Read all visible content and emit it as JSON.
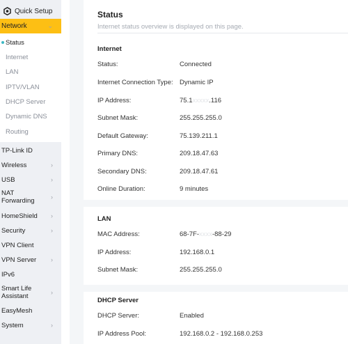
{
  "brand": {
    "label": "Quick Setup",
    "icon": "gear-icon"
  },
  "nav": {
    "active": {
      "label": "Network",
      "icon": "chevron-down-icon"
    },
    "sub_items": [
      "Status",
      "Internet",
      "LAN",
      "IPTV/VLAN",
      "DHCP Server",
      "Dynamic DNS",
      "Routing"
    ],
    "items": [
      "TP-Link ID",
      "Wireless",
      "USB",
      "NAT Forwarding",
      "HomeShield",
      "Security",
      "VPN Client",
      "VPN Server",
      "IPv6",
      "Smart Life Assistant",
      "EasyMesh",
      "System"
    ]
  },
  "page": {
    "title": "Status",
    "subtitle": "Internet status overview is displayed on this page."
  },
  "internet": {
    "title": "Internet",
    "rows": [
      {
        "label": "Status:",
        "value": "Connected"
      },
      {
        "label": "Internet Connection Type:",
        "value": "Dynamic IP"
      },
      {
        "label": "IP Address:",
        "value": "75.1",
        "masked": "xxxxx",
        "value_end": ".116"
      },
      {
        "label": "Subnet Mask:",
        "value": "255.255.255.0"
      },
      {
        "label": "Default Gateway:",
        "value": "75.139.211.1"
      },
      {
        "label": "Primary DNS:",
        "value": "209.18.47.63"
      },
      {
        "label": "Secondary DNS:",
        "value": "209.18.47.61"
      },
      {
        "label": "Online Duration:",
        "value": "9 minutes"
      }
    ]
  },
  "lan": {
    "title": "LAN",
    "rows": [
      {
        "label": "MAC Address:",
        "value": "68-7F-",
        "masked": "xxxx",
        "value_end": "-88-29"
      },
      {
        "label": "IP Address:",
        "value": "192.168.0.1"
      },
      {
        "label": "Subnet Mask:",
        "value": "255.255.255.0"
      }
    ]
  },
  "dhcp": {
    "title": "DHCP Server",
    "rows": [
      {
        "label": "DHCP Server:",
        "value": "Enabled"
      },
      {
        "label": "IP Address Pool:",
        "value": "192.168.0.2 - 192.168.0.253"
      }
    ]
  },
  "colors": {
    "accent": "#fdbf14",
    "status_dot": "#3cb8c4",
    "sidebar_bg": "#eef0f4",
    "main_bg": "#f4f6f8"
  }
}
